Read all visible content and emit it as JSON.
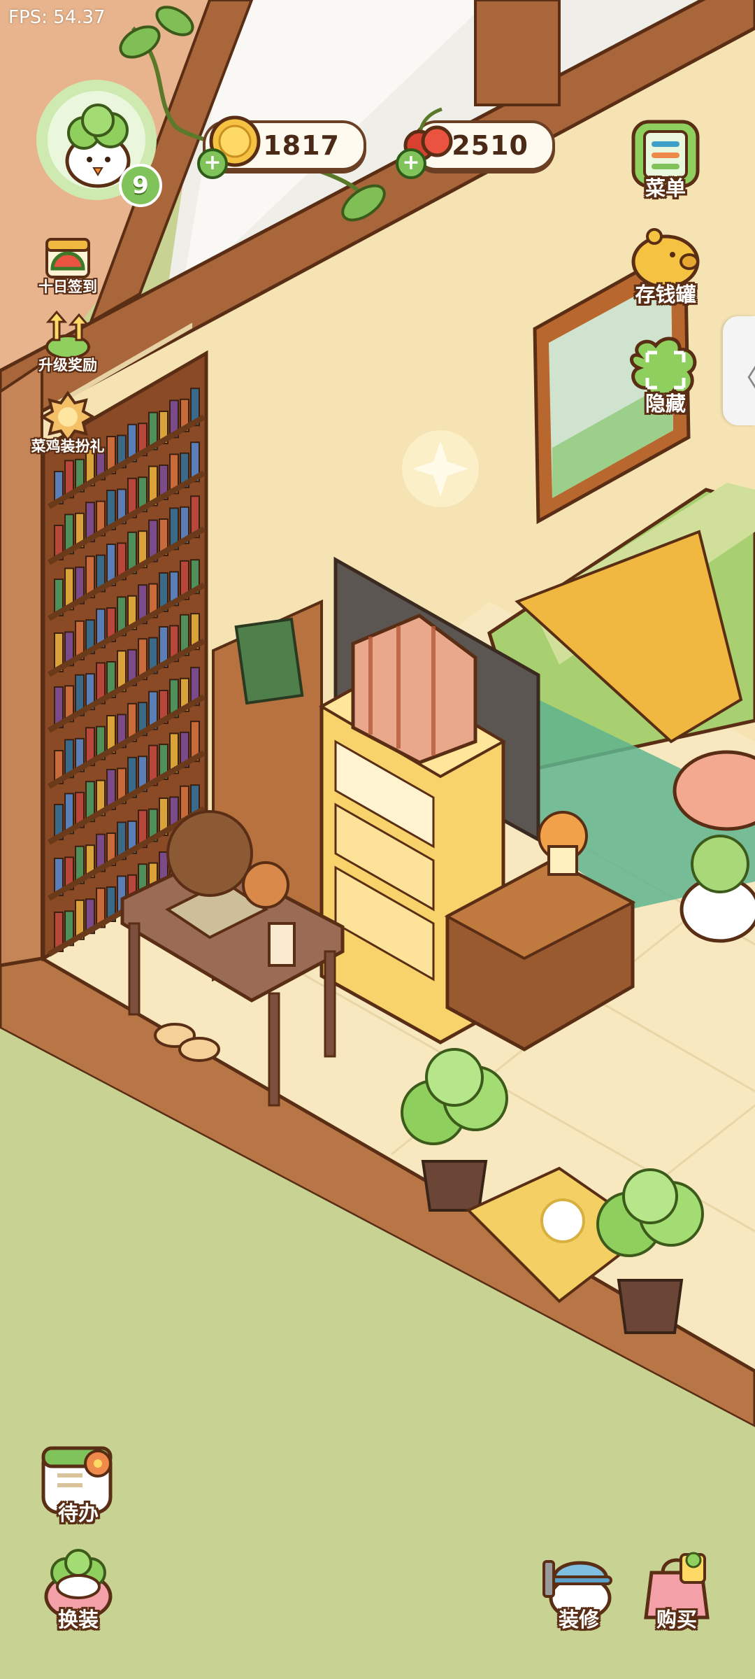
{
  "hud": {
    "fps": "FPS: 54.37",
    "player_level": "9",
    "coins": "1817",
    "cherries": "2510"
  },
  "left_menu": [
    {
      "label": "十日签到",
      "icon": "calendar-watermelon-icon"
    },
    {
      "label": "升级奖励",
      "icon": "level-up-reward-icon"
    },
    {
      "label": "菜鸡装扮礼",
      "icon": "costume-gift-icon"
    }
  ],
  "right_menu": [
    {
      "label": "菜单",
      "icon": "menu-list-icon"
    },
    {
      "label": "存钱罐",
      "icon": "piggy-bank-icon"
    },
    {
      "label": "隐藏",
      "icon": "hide-ui-icon"
    }
  ],
  "bottom_left": [
    {
      "label": "待办",
      "icon": "todo-calendar-icon"
    },
    {
      "label": "换装",
      "icon": "dress-up-icon"
    }
  ],
  "bottom_right": [
    {
      "label": "装修",
      "icon": "renovate-icon"
    },
    {
      "label": "购买",
      "icon": "shop-bag-icon"
    }
  ],
  "colors": {
    "wall": "#f6e3b4",
    "wood": "#a9663a",
    "floor": "#f7e8c0",
    "grass": "#c8d293",
    "outline": "#5a2e15",
    "coin": "#f5c242",
    "leaf_green": "#8fcf5e"
  }
}
